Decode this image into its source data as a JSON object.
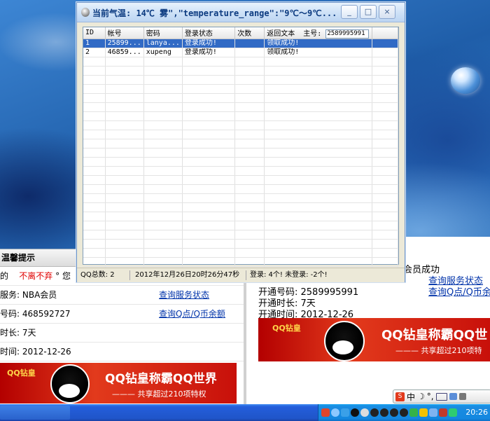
{
  "app": {
    "title": "当前气温: 14℃   雾\",\"temperature_range\":\"9℃～9℃...",
    "buttons": {
      "minimize": "_",
      "maximize": "□",
      "close": "×"
    },
    "columns": [
      "ID",
      "帐号",
      "密码",
      "登录状态",
      "次数",
      "返回文本",
      "主号:"
    ],
    "main_account_input": "2589995991",
    "rows": [
      {
        "id": "1",
        "account": "25899...",
        "password": "lanya...",
        "status": "登录成功!",
        "count": "",
        "return_text": "领取成功!"
      },
      {
        "id": "2",
        "account": "46859...",
        "password": "xupeng",
        "status": "登录成功!",
        "count": "",
        "return_text": "领取成功!"
      }
    ],
    "status": {
      "total": "QQ总数: 2",
      "datetime": "2012年12月26日20时26分47秒",
      "login": "登录: 4个! 未登录: -2个!"
    }
  },
  "left_panel": {
    "header": "温馨提示",
    "greeting_prefix": "的",
    "greeting_red": "不离不弃",
    "greeting_suffix": "°    您",
    "rows": [
      {
        "text": "服务: NBA会员",
        "link": "查询服务状态"
      },
      {
        "text": "号码: 468592727",
        "link": "查询Q点/Q币余额"
      },
      {
        "text": "时长: 7天",
        "link": ""
      },
      {
        "text": "时间: 2012-12-26",
        "link": ""
      }
    ],
    "banner": {
      "logo": "QQ钻皇",
      "title": "QQ钻皇称霸QQ世界",
      "subtitle": "——— 共享超过210项特权"
    }
  },
  "right_panel": {
    "top_text": "会员成功",
    "links": [
      "查询服务状态",
      "查询Q点/Q币余"
    ],
    "lines": [
      "开通号码: 2589995991",
      "开通时长: 7天",
      "开通时间: 2012-12-26"
    ],
    "banner": {
      "logo": "QQ钻皇",
      "title": "QQ钻皇称霸QQ世",
      "subtitle": "——— 共享超过210项特"
    }
  },
  "ime": {
    "s": "S",
    "chinese": "中",
    "moon": "☽",
    "dot": "°,"
  },
  "taskbar": {
    "clock": "20:26"
  },
  "colors": {
    "selection": "#316ac5",
    "link": "#0033aa",
    "banner_red": "#c8100a",
    "taskbar_blue": "#245edb"
  }
}
